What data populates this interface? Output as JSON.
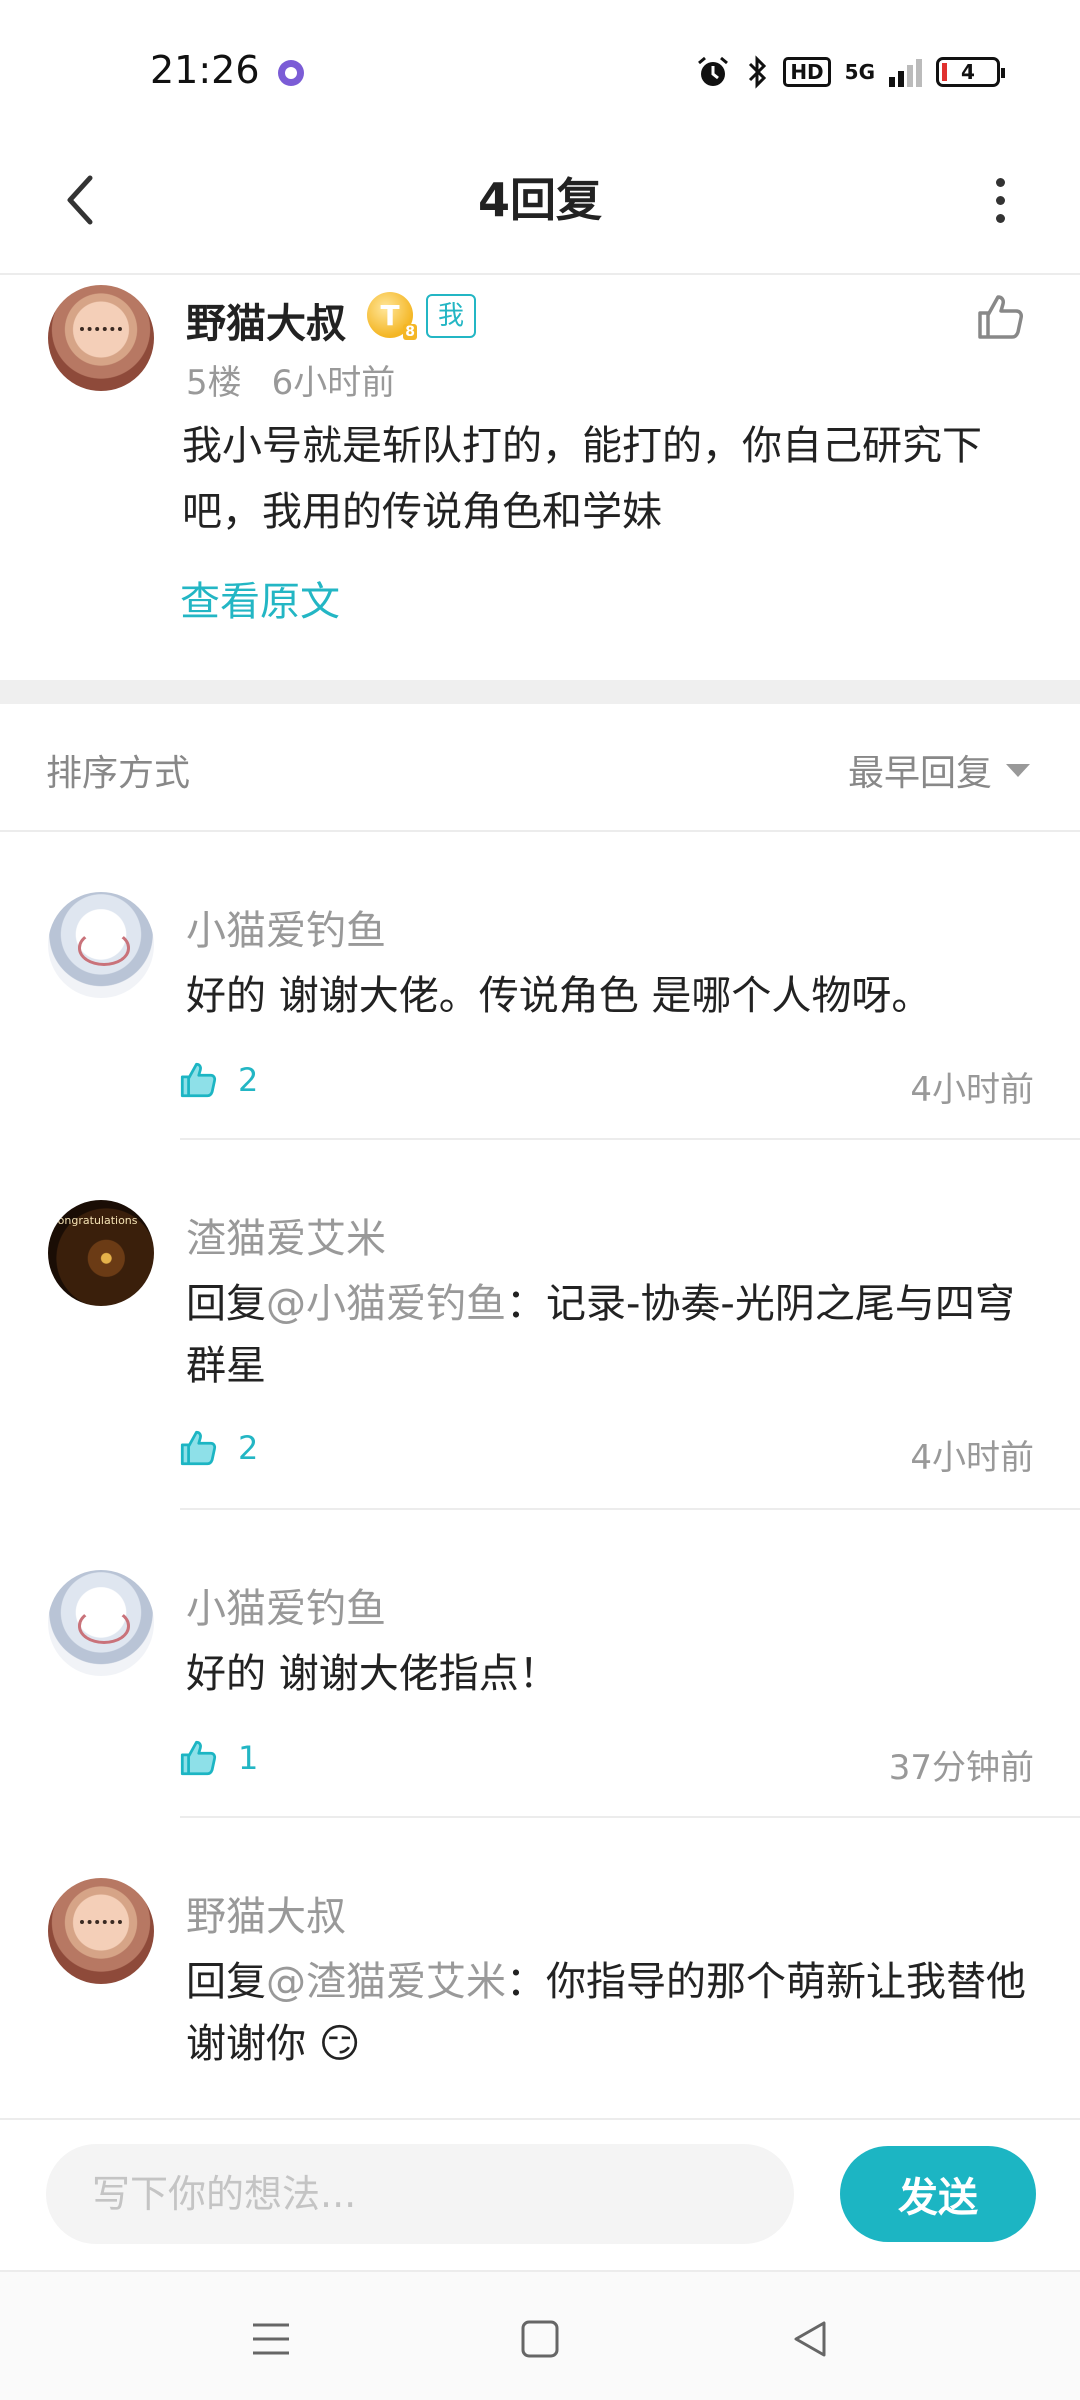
{
  "status_bar": {
    "time": "21:26",
    "hd_label": "HD",
    "network_label": "5G",
    "battery_level": "4"
  },
  "header": {
    "title": "4回复"
  },
  "post": {
    "author": "野猫大叔",
    "level_badge": "T",
    "level_sub": "8",
    "me_badge": "我",
    "floor": "5楼",
    "time": "6小时前",
    "content": "我小号就是斩队打的，能打的，你自己研究下吧，我用的传说角色和学妹",
    "view_original": "查看原文"
  },
  "sort": {
    "label": "排序方式",
    "value": "最早回复"
  },
  "replies": [
    {
      "name": "小猫爱钓鱼",
      "prefix": "",
      "mention": "",
      "text": "好的 谢谢大佬。传说角色 是哪个人物呀。",
      "likes": "2",
      "time": "4小时前"
    },
    {
      "name": "渣猫爱艾米",
      "prefix": "回复",
      "mention": "@小猫爱钓鱼",
      "text": "：记录-协奏-光阴之尾与四穹群星",
      "likes": "2",
      "time": "4小时前"
    },
    {
      "name": "小猫爱钓鱼",
      "prefix": "",
      "mention": "",
      "text": "好的 谢谢大佬指点！",
      "likes": "1",
      "time": "37分钟前"
    },
    {
      "name": "野猫大叔",
      "prefix": "回复",
      "mention": "@渣猫爱艾米",
      "text": "：你指导的那个萌新让我替他谢谢你 😏",
      "likes": "",
      "time": ""
    }
  ],
  "input": {
    "placeholder": "写下你的想法...",
    "send_label": "发送"
  },
  "colors": {
    "accent": "#1cb5c3",
    "text_primary": "#222222",
    "text_secondary": "#999999"
  }
}
